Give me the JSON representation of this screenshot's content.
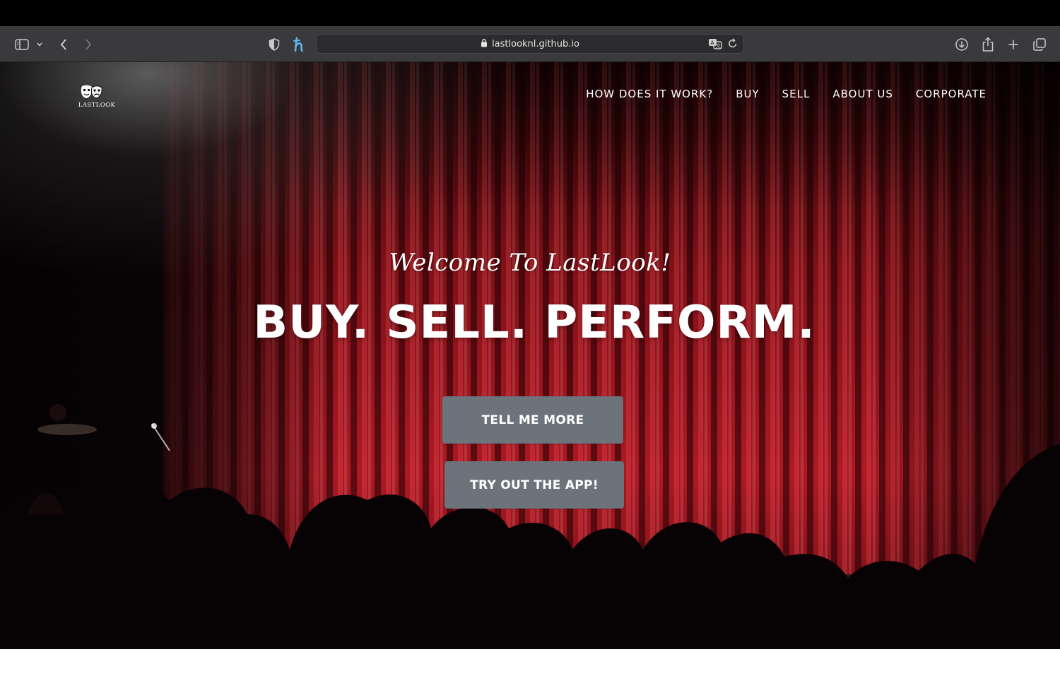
{
  "browser": {
    "url": "lastlooknl.github.io",
    "icons": [
      "sidebar-icon",
      "chevron-down-icon",
      "back-arrow-icon",
      "forward-arrow-icon",
      "shield-icon",
      "extension-h-icon",
      "lock-icon",
      "translate-icon",
      "reload-icon",
      "download-icon",
      "share-icon",
      "new-tab-icon",
      "tabs-overview-icon"
    ]
  },
  "site": {
    "logo_text": "LASTLOOK",
    "nav": [
      "HOW DOES IT WORK?",
      "BUY",
      "SELL",
      "ABOUT US",
      "CORPORATE"
    ],
    "hero": {
      "subheading": "Welcome To LastLook!",
      "heading": "BUY. SELL. PERFORM.",
      "buttons": [
        "TELL ME MORE",
        "TRY OUT THE APP!"
      ]
    }
  },
  "colors": {
    "button_bg": "#6c737b",
    "curtain_red": "#b01822",
    "toolbar_bg": "#3a3a3c"
  }
}
